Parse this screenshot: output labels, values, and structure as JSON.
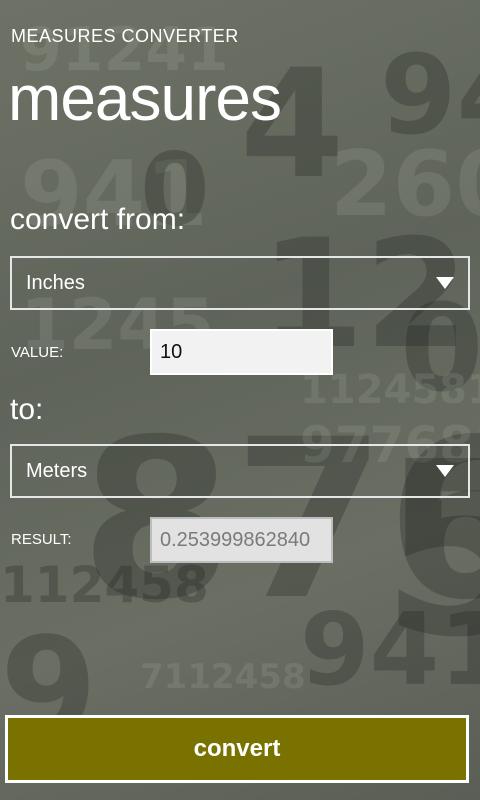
{
  "app": {
    "title": "MEASURES CONVERTER"
  },
  "page": {
    "title": "measures"
  },
  "from_section": {
    "label": "convert from:",
    "selected": "Inches"
  },
  "value_field": {
    "label": "VALUE:",
    "value": "10"
  },
  "to_section": {
    "label": "to:",
    "selected": "Meters"
  },
  "result_field": {
    "label": "RESULT:",
    "value": "0.253999862840"
  },
  "convert_button": {
    "label": "convert"
  },
  "colors": {
    "accent": "#7a7200",
    "background": "#63675d",
    "foreground": "#ffffff"
  },
  "icons": {
    "dropdown": "chevron-down-icon"
  }
}
